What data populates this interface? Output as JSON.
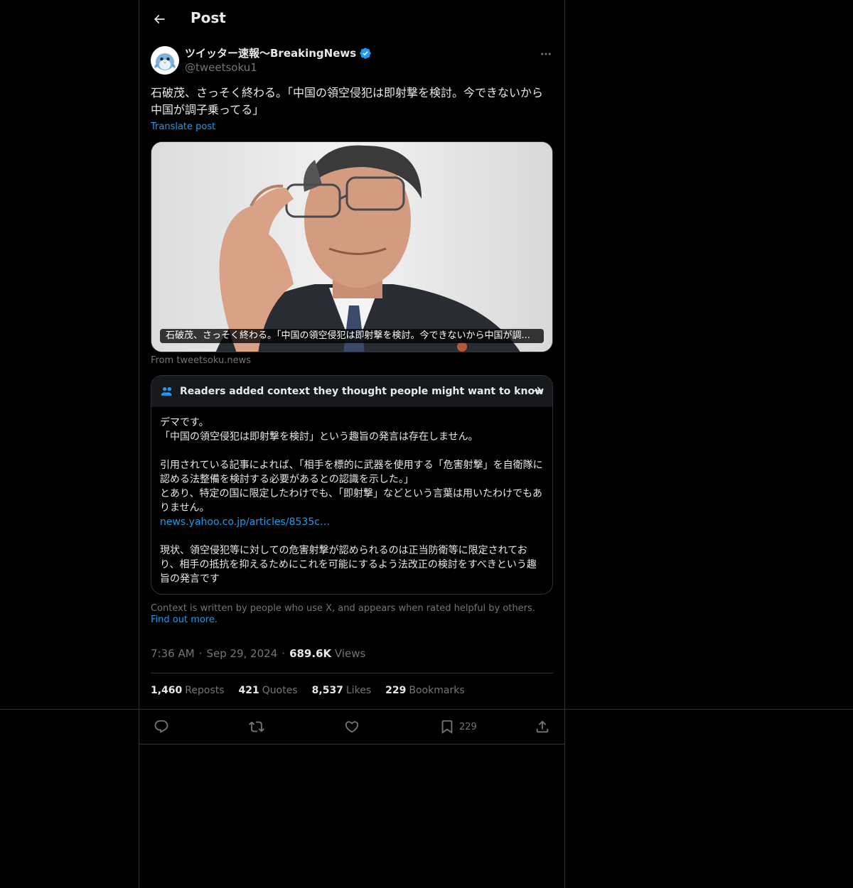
{
  "header": {
    "title": "Post"
  },
  "author": {
    "name": "ツイッター速報〜BreakingNews",
    "handle": "@tweetsoku1"
  },
  "post": {
    "text": "石破茂、さっそく終わる。「中国の領空侵犯は即射撃を検討。今できないから中国が調子乗ってる」",
    "translate_label": "Translate post"
  },
  "media": {
    "caption": "石破茂、さっそく終わる。「中国の領空侵犯は即射撃を検討。今できないから中国が調...",
    "source": "From tweetsoku.news"
  },
  "note": {
    "title": "Readers added context they thought people might want to know",
    "line1": "デマです。",
    "line2": "「中国の領空侵犯は即射撃を検討」という趣旨の発言は存在しません。",
    "line3": "引用されている記事によれば、「相手を標的に武器を使用する「危害射撃」を自衛隊に認める法整備を検討する必要があるとの認識を示した。」",
    "line4": "とあり、特定の国に限定したわけでも、「即射撃」などという言葉は用いたわけでもありません。",
    "link": "news.yahoo.co.jp/articles/8535c…",
    "line5": "現状、領空侵犯等に対しての危害射撃が認められるのは正当防衛等に限定されており、相手の抵抗を抑えるためにこれを可能にするよう法改正の検討をすべきという趣旨の発言です"
  },
  "context_footer": {
    "text": "Context is written by people who use X, and appears when rated helpful by others.",
    "link": "Find out more."
  },
  "meta": {
    "time": "7:36 AM",
    "separator": "·",
    "date": "Sep 29, 2024",
    "views_count": "689.6K",
    "views_label": "Views"
  },
  "stats": {
    "reposts_count": "1,460",
    "reposts_label": "Reposts",
    "quotes_count": "421",
    "quotes_label": "Quotes",
    "likes_count": "8,537",
    "likes_label": "Likes",
    "bookmarks_count": "229",
    "bookmarks_label": "Bookmarks"
  },
  "actions": {
    "bookmark_count": "229"
  },
  "icons": {
    "back": "arrow-left-icon",
    "verified": "verified-badge-icon",
    "more": "more-horizontal-icon",
    "note": "people-icon",
    "note_arrow": "arrow-right-icon",
    "reply": "reply-icon",
    "repost": "repost-icon",
    "like": "heart-icon",
    "bookmark": "bookmark-icon",
    "share": "share-icon"
  },
  "colors": {
    "background": "#000000",
    "text": "#e7e9ea",
    "muted": "#71767b",
    "accent": "#1d9bf0",
    "border": "#2f3336"
  }
}
